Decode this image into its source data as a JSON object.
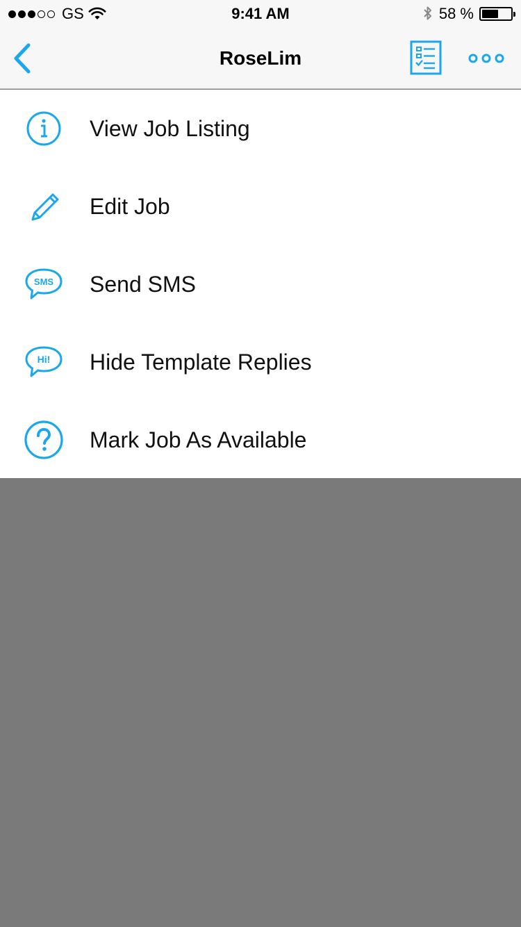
{
  "status_bar": {
    "carrier": "GS",
    "time": "9:41 AM",
    "battery_text": "58 %",
    "battery_level": 0.58,
    "signal_bars_filled": 3,
    "signal_bars_total": 5
  },
  "nav": {
    "title": "RoseLim",
    "back_icon": "chevron-left-icon",
    "checklist_icon": "checklist-icon",
    "more_icon": "more-dots-icon"
  },
  "menu": {
    "items": [
      {
        "label": "View Job Listing",
        "icon": "info-icon"
      },
      {
        "label": "Edit Job",
        "icon": "pencil-icon"
      },
      {
        "label": "Send SMS",
        "icon": "sms-bubble-icon",
        "icon_text": "SMS"
      },
      {
        "label": "Hide Template Replies",
        "icon": "hi-bubble-icon",
        "icon_text": "Hi!"
      },
      {
        "label": "Mark Job As Available",
        "icon": "question-icon"
      }
    ]
  },
  "colors": {
    "accent": "#1aa7ec",
    "nav_bg": "#f7f7f7",
    "overlay": "#7a7a7a",
    "text": "#111111"
  }
}
